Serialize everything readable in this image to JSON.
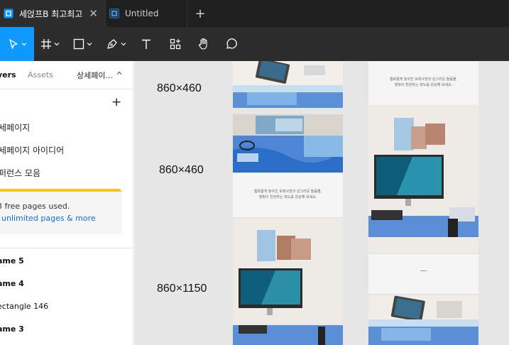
{
  "tabs": [
    {
      "label": "세얹프B 최고최고",
      "active": true,
      "close": "✕"
    },
    {
      "label": "Untitled",
      "active": false
    }
  ],
  "new_tab": "+",
  "toolbar": {
    "tools": [
      "move-tool",
      "frame-tool",
      "shape-tool",
      "pen-tool",
      "text-tool",
      "resources-tool",
      "hand-tool",
      "comment-tool"
    ]
  },
  "sidebar": {
    "tabs": {
      "layers": "yers",
      "assets": "Assets",
      "page": "상세페이..."
    },
    "add_page": "+",
    "pages": [
      "세페이지",
      "세페이지 아이디어",
      "퍼런스 모음"
    ],
    "upsell": {
      "line1": "3 free pages used.",
      "line2": "unlimited pages & more"
    },
    "layers": [
      {
        "label": "ame 5",
        "bold": true
      },
      {
        "label": "ame 4",
        "bold": true
      },
      {
        "label": "ectangle 146",
        "bold": false
      },
      {
        "label": "ame 3",
        "bold": true
      }
    ]
  },
  "canvas": {
    "dimensions": [
      "860×460",
      "860×460",
      "860×1150"
    ],
    "captions": {
      "a": [
        "햄화롭게 놓아진 모래사장과 싱그러운 돌음물,",
        "햇빛이 찬란하는 파도를 감상해 보세요."
      ],
      "b": [
        "햄화롭게 놓아진 모래사장과 싱그러운 돌음물,",
        "햇빛이 찬란하는 파도를 감상해 보세요."
      ],
      "dash": "—"
    }
  },
  "colors": {
    "tabbar": "#1f1f1f",
    "toolbar": "#2c2c2c",
    "accent": "#0d99ff",
    "upsell_bar": "#ffc21a",
    "link": "#0d6fd9",
    "canvas": "#e6e6e6"
  }
}
